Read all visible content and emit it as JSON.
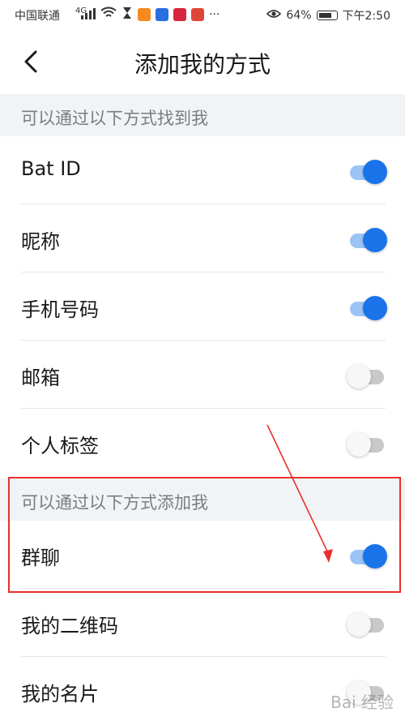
{
  "status_bar": {
    "carrier": "中国联通",
    "network": "4G",
    "eye_icon": "eye-icon",
    "battery": "64%",
    "time": "下午2:50",
    "more": "···"
  },
  "nav": {
    "title": "添加我的方式",
    "back_icon": "chevron-left-icon"
  },
  "sections": [
    {
      "header": "可以通过以下方式找到我"
    },
    {
      "header": "可以通过以下方式添加我"
    }
  ],
  "find_me": [
    {
      "label": "Bat ID",
      "enabled": true
    },
    {
      "label": "昵称",
      "enabled": true
    },
    {
      "label": "手机号码",
      "enabled": true
    },
    {
      "label": "邮箱",
      "enabled": false
    },
    {
      "label": "个人标签",
      "enabled": false
    }
  ],
  "add_me": [
    {
      "label": "群聊",
      "enabled": true
    },
    {
      "label": "我的二维码",
      "enabled": false
    },
    {
      "label": "我的名片",
      "enabled": false
    }
  ],
  "colors": {
    "toggle_on": "#1a73e8",
    "toggle_on_track": "#9cc4f6",
    "toggle_off_track": "#c9c9c9",
    "annotation": "#e8302e"
  }
}
